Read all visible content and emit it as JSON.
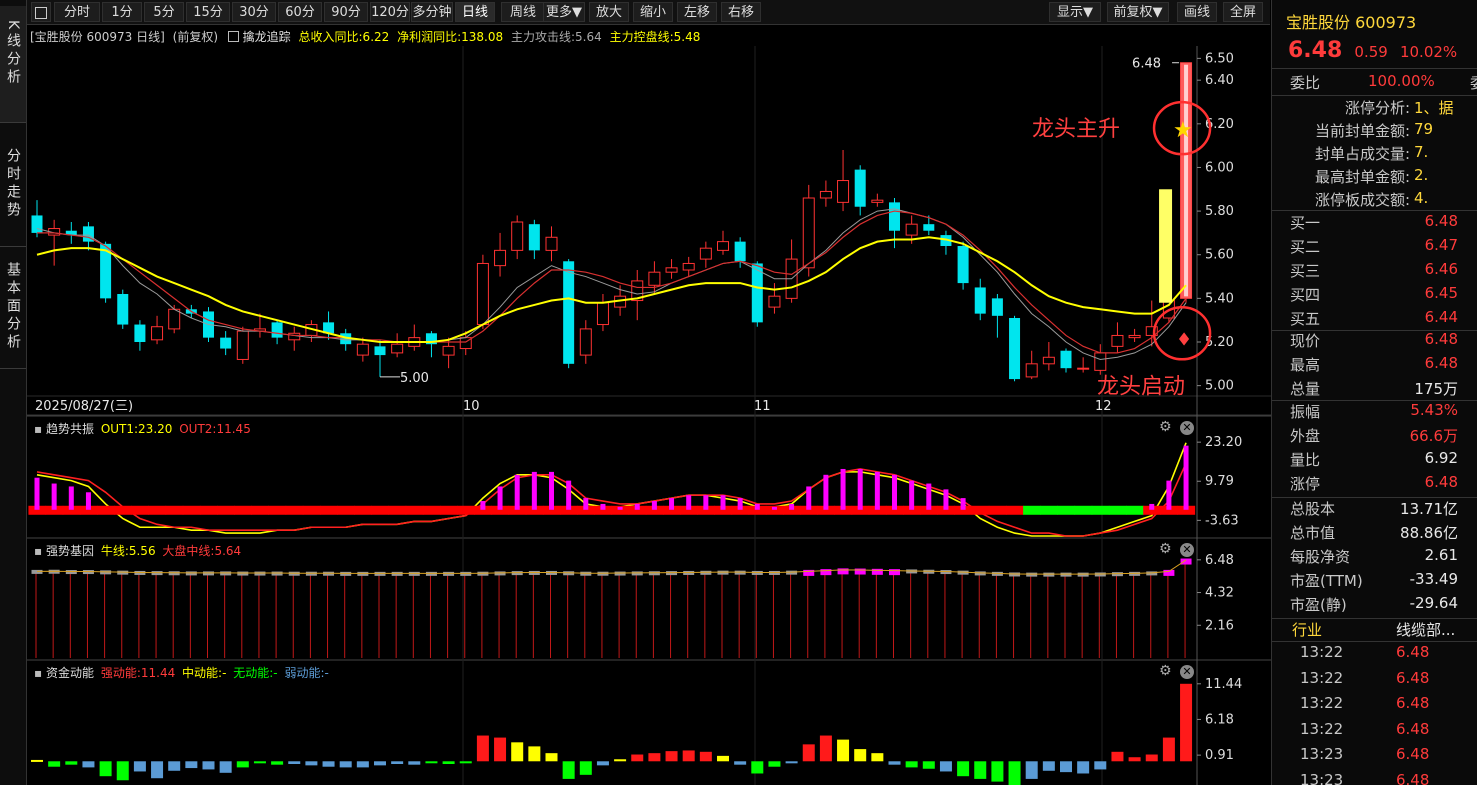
{
  "left_tabs": [
    "K线分析",
    "分时走势",
    "基本面分析"
  ],
  "toolbar": {
    "items": [
      "分时",
      "1分",
      "5分",
      "15分",
      "30分",
      "60分",
      "90分",
      "120分",
      "多分钟",
      "日线",
      "周线",
      "更多▼",
      "放大",
      "缩小",
      "左移",
      "右移"
    ],
    "active": "日线",
    "right_items": [
      "显示▼",
      "前复权▼",
      "画线",
      "全屏"
    ]
  },
  "main_header": {
    "title": "[宝胜股份 600973 日线]",
    "adj": "(前复权)",
    "indicator": "擒龙追踪",
    "rev_label": "总收入同比:6.22",
    "profit_label": "净利润同比:138.08",
    "attack_label": "主力攻击线:5.64",
    "control_label": "主力控盘线:5.48"
  },
  "annotations": {
    "top_right_price": "6.48",
    "low_price": "5.00",
    "dragon_up": "龙头主升",
    "dragon_start": "龙头启动"
  },
  "x_labels": [
    "2025/08/27(三)",
    "10",
    "11",
    "12"
  ],
  "panel2": {
    "title": "趋势共振",
    "out1": "OUT1:23.20",
    "out2": "OUT2:11.45",
    "ticks": [
      "23.20",
      "9.79",
      "-3.63"
    ]
  },
  "panel3": {
    "title": "强势基因",
    "bull": "牛线:5.56",
    "mid": "大盘中线:5.64",
    "ticks": [
      "6.48",
      "4.32",
      "2.16"
    ]
  },
  "panel4": {
    "title": "资金动能",
    "strong": "强动能:11.44",
    "medium": "中动能:-",
    "none": "无动能:-",
    "weak": "弱动能:-",
    "ticks": [
      "11.44",
      "6.18",
      "0.91"
    ]
  },
  "colors": {
    "up": "#ff3232",
    "down": "#00e5ee",
    "ma_yellow": "#ffff00",
    "magenta": "#ff00ff",
    "green": "#00ff00",
    "blue": "#5b9bd5"
  },
  "quote": {
    "name": "宝胜股份",
    "code": "600973",
    "price": "6.48",
    "change": "0.59",
    "pct": "10.02%",
    "weibi_label": "委比",
    "weibi": "100.00%",
    "weibi_unit": "委"
  },
  "limit_info": [
    {
      "label": "涨停分析:",
      "value": "1、据"
    },
    {
      "label": "当前封单金额:",
      "value": "79"
    },
    {
      "label": "封单占成交量:",
      "value": "7."
    },
    {
      "label": "最高封单金额:",
      "value": "2."
    },
    {
      "label": "涨停板成交额:",
      "value": "4."
    }
  ],
  "order_book": [
    {
      "label": "买一",
      "value": "6.48"
    },
    {
      "label": "买二",
      "value": "6.47"
    },
    {
      "label": "买三",
      "value": "6.46"
    },
    {
      "label": "买四",
      "value": "6.45"
    },
    {
      "label": "买五",
      "value": "6.44"
    }
  ],
  "stats1": [
    {
      "label": "现价",
      "value": "6.48",
      "color": "red"
    },
    {
      "label": "最高",
      "value": "6.48",
      "color": "red"
    },
    {
      "label": "总量",
      "value": "175万",
      "color": "white"
    }
  ],
  "stats2": [
    {
      "label": "振幅",
      "value": "5.43%",
      "color": "red"
    },
    {
      "label": "外盘",
      "value": "66.6万",
      "color": "red"
    },
    {
      "label": "量比",
      "value": "6.92",
      "color": "white"
    },
    {
      "label": "涨停",
      "value": "6.48",
      "color": "red"
    }
  ],
  "stats3": [
    {
      "label": "总股本",
      "value": "13.71亿",
      "color": "white"
    },
    {
      "label": "总市值",
      "value": "88.86亿",
      "color": "white"
    },
    {
      "label": "每股净资",
      "value": "2.61",
      "color": "white"
    },
    {
      "label": "市盈(TTM)",
      "value": "-33.49",
      "color": "white"
    },
    {
      "label": "市盈(静)",
      "value": "-29.64",
      "color": "white"
    }
  ],
  "industry": {
    "label": "行业",
    "value": "线缆部..."
  },
  "ticks_list": [
    {
      "time": "13:22",
      "price": "6.48"
    },
    {
      "time": "13:22",
      "price": "6.48"
    },
    {
      "time": "13:22",
      "price": "6.48"
    },
    {
      "time": "13:22",
      "price": "6.48"
    },
    {
      "time": "13:23",
      "price": "6.48"
    },
    {
      "time": "13:23",
      "price": "6.48"
    }
  ],
  "chart_data": {
    "type": "candlestick",
    "y_ticks": [
      "6.50",
      "6.40",
      "6.20",
      "6.00",
      "5.80",
      "5.60",
      "5.40",
      "5.20",
      "5.00"
    ],
    "ylim": [
      4.98,
      6.52
    ],
    "candles": [
      [
        5.78,
        5.7,
        5.85,
        5.68
      ],
      [
        5.69,
        5.72,
        5.76,
        5.55
      ],
      [
        5.71,
        5.69,
        5.75,
        5.65
      ],
      [
        5.73,
        5.66,
        5.75,
        5.62
      ],
      [
        5.65,
        5.4,
        5.66,
        5.38
      ],
      [
        5.42,
        5.28,
        5.44,
        5.26
      ],
      [
        5.28,
        5.2,
        5.3,
        5.16
      ],
      [
        5.21,
        5.27,
        5.32,
        5.19
      ],
      [
        5.26,
        5.35,
        5.37,
        5.24
      ],
      [
        5.35,
        5.33,
        5.37,
        5.31
      ],
      [
        5.34,
        5.22,
        5.36,
        5.2
      ],
      [
        5.22,
        5.17,
        5.25,
        5.14
      ],
      [
        5.12,
        5.25,
        5.27,
        5.1
      ],
      [
        5.25,
        5.26,
        5.33,
        5.22
      ],
      [
        5.29,
        5.22,
        5.3,
        5.19
      ],
      [
        5.21,
        5.24,
        5.27,
        5.16
      ],
      [
        5.23,
        5.28,
        5.3,
        5.2
      ],
      [
        5.29,
        5.24,
        5.34,
        5.21
      ],
      [
        5.24,
        5.19,
        5.26,
        5.16
      ],
      [
        5.14,
        5.19,
        5.22,
        5.11
      ],
      [
        5.18,
        5.14,
        5.21,
        5.04
      ],
      [
        5.15,
        5.19,
        5.24,
        5.13
      ],
      [
        5.18,
        5.22,
        5.28,
        5.16
      ],
      [
        5.24,
        5.19,
        5.25,
        5.13
      ],
      [
        5.14,
        5.18,
        5.22,
        5.08
      ],
      [
        5.17,
        5.22,
        5.25,
        5.14
      ],
      [
        5.28,
        5.56,
        5.6,
        5.26
      ],
      [
        5.55,
        5.62,
        5.7,
        5.5
      ],
      [
        5.62,
        5.75,
        5.78,
        5.58
      ],
      [
        5.74,
        5.62,
        5.76,
        5.58
      ],
      [
        5.62,
        5.68,
        5.73,
        5.57
      ],
      [
        5.57,
        5.1,
        5.58,
        5.08
      ],
      [
        5.14,
        5.26,
        5.3,
        5.1
      ],
      [
        5.28,
        5.38,
        5.42,
        5.25
      ],
      [
        5.36,
        5.41,
        5.46,
        5.32
      ],
      [
        5.39,
        5.48,
        5.53,
        5.3
      ],
      [
        5.46,
        5.52,
        5.57,
        5.42
      ],
      [
        5.52,
        5.54,
        5.58,
        5.49
      ],
      [
        5.53,
        5.56,
        5.59,
        5.5
      ],
      [
        5.58,
        5.63,
        5.66,
        5.54
      ],
      [
        5.62,
        5.66,
        5.71,
        5.6
      ],
      [
        5.66,
        5.57,
        5.68,
        5.54
      ],
      [
        5.56,
        5.29,
        5.57,
        5.27
      ],
      [
        5.36,
        5.41,
        5.47,
        5.33
      ],
      [
        5.4,
        5.58,
        5.67,
        5.38
      ],
      [
        5.54,
        5.86,
        5.92,
        5.5
      ],
      [
        5.86,
        5.89,
        5.94,
        5.82
      ],
      [
        5.84,
        5.94,
        6.08,
        5.8
      ],
      [
        5.99,
        5.82,
        6.01,
        5.78
      ],
      [
        5.84,
        5.85,
        5.88,
        5.82
      ],
      [
        5.84,
        5.71,
        5.86,
        5.63
      ],
      [
        5.69,
        5.74,
        5.78,
        5.65
      ],
      [
        5.74,
        5.71,
        5.78,
        5.69
      ],
      [
        5.69,
        5.64,
        5.71,
        5.6
      ],
      [
        5.64,
        5.47,
        5.66,
        5.44
      ],
      [
        5.45,
        5.33,
        5.49,
        5.3
      ],
      [
        5.4,
        5.32,
        5.42,
        5.22
      ],
      [
        5.31,
        5.03,
        5.32,
        5.02
      ],
      [
        5.04,
        5.1,
        5.16,
        5.03
      ],
      [
        5.1,
        5.13,
        5.2,
        5.07
      ],
      [
        5.16,
        5.08,
        5.17,
        5.06
      ],
      [
        5.08,
        5.08,
        5.13,
        5.06
      ],
      [
        5.07,
        5.15,
        5.19,
        5.05
      ],
      [
        5.18,
        5.23,
        5.29,
        5.15
      ],
      [
        5.22,
        5.23,
        5.26,
        5.2
      ],
      [
        5.23,
        5.27,
        5.39,
        5.18
      ],
      [
        5.31,
        5.39,
        5.55,
        5.29
      ],
      [
        5.4,
        6.48,
        6.48,
        5.38
      ]
    ],
    "ma_gray": [
      5.72,
      5.7,
      5.69,
      5.69,
      5.64,
      5.55,
      5.47,
      5.42,
      5.35,
      5.31,
      5.28,
      5.27,
      5.25,
      5.25,
      5.24,
      5.23,
      5.22,
      5.22,
      5.21,
      5.21,
      5.2,
      5.2,
      5.2,
      5.2,
      5.21,
      5.22,
      5.28,
      5.36,
      5.45,
      5.5,
      5.55,
      5.52,
      5.5,
      5.47,
      5.44,
      5.42,
      5.43,
      5.47,
      5.5,
      5.53,
      5.56,
      5.57,
      5.53,
      5.49,
      5.49,
      5.56,
      5.62,
      5.7,
      5.76,
      5.8,
      5.81,
      5.79,
      5.77,
      5.74,
      5.68,
      5.6,
      5.52,
      5.42,
      5.33,
      5.27,
      5.2,
      5.15,
      5.12,
      5.13,
      5.15,
      5.19,
      5.27,
      5.38
    ],
    "ma_red": [
      5.7,
      5.7,
      5.69,
      5.68,
      5.64,
      5.58,
      5.52,
      5.46,
      5.4,
      5.34,
      5.3,
      5.28,
      5.26,
      5.25,
      5.24,
      5.23,
      5.23,
      5.22,
      5.22,
      5.21,
      5.21,
      5.2,
      5.2,
      5.2,
      5.2,
      5.2,
      5.25,
      5.32,
      5.4,
      5.47,
      5.53,
      5.53,
      5.52,
      5.5,
      5.47,
      5.45,
      5.45,
      5.47,
      5.5,
      5.53,
      5.56,
      5.57,
      5.55,
      5.52,
      5.51,
      5.56,
      5.61,
      5.68,
      5.74,
      5.78,
      5.8,
      5.79,
      5.77,
      5.74,
      5.69,
      5.62,
      5.54,
      5.45,
      5.37,
      5.3,
      5.23,
      5.18,
      5.15,
      5.15,
      5.17,
      5.22,
      5.29,
      5.4
    ],
    "ma_yellow": [
      5.6,
      5.62,
      5.63,
      5.63,
      5.62,
      5.58,
      5.54,
      5.5,
      5.47,
      5.44,
      5.41,
      5.37,
      5.34,
      5.32,
      5.3,
      5.28,
      5.26,
      5.24,
      5.22,
      5.21,
      5.2,
      5.2,
      5.2,
      5.2,
      5.21,
      5.24,
      5.28,
      5.32,
      5.35,
      5.37,
      5.39,
      5.4,
      5.38,
      5.38,
      5.39,
      5.4,
      5.42,
      5.44,
      5.46,
      5.47,
      5.47,
      5.47,
      5.45,
      5.44,
      5.45,
      5.48,
      5.52,
      5.58,
      5.63,
      5.66,
      5.67,
      5.67,
      5.68,
      5.67,
      5.65,
      5.61,
      5.57,
      5.52,
      5.46,
      5.41,
      5.38,
      5.36,
      5.35,
      5.34,
      5.33,
      5.33,
      5.37,
      5.46
    ],
    "panel2": {
      "range": [
        -9.0,
        26.0
      ],
      "magenta_bars": [
        11,
        9,
        8,
        6,
        0,
        0,
        0,
        0,
        0,
        0,
        0,
        0,
        0,
        0,
        0,
        0,
        0,
        0,
        0,
        0,
        0,
        0,
        0,
        0,
        0,
        0,
        3,
        8,
        12,
        13,
        13,
        10,
        4,
        2,
        1,
        2,
        3,
        4,
        5,
        5,
        5,
        4,
        2,
        1,
        2,
        8,
        12,
        14,
        14,
        13,
        12,
        10,
        9,
        7,
        4,
        0,
        0,
        0,
        0,
        0,
        0,
        0,
        0,
        0,
        0,
        2,
        10,
        22
      ],
      "bar_state": [
        "m",
        "m",
        "m",
        "m",
        "r",
        "r",
        "r",
        "r",
        "r",
        "r",
        "r",
        "r",
        "r",
        "r",
        "r",
        "r",
        "r",
        "r",
        "r",
        "r",
        "r",
        "r",
        "r",
        "r",
        "r",
        "r",
        "m",
        "m",
        "m",
        "m",
        "m",
        "m",
        "m",
        "m",
        "m",
        "m",
        "m",
        "m",
        "m",
        "m",
        "m",
        "m",
        "m",
        "m",
        "m",
        "m",
        "m",
        "m",
        "m",
        "m",
        "m",
        "m",
        "m",
        "m",
        "m",
        "r",
        "r",
        "r",
        "g",
        "g",
        "g",
        "g",
        "g",
        "g",
        "g",
        "r",
        "r",
        "m"
      ],
      "out1": [
        12,
        11,
        10,
        8,
        2,
        -3,
        -6,
        -6,
        -6,
        -7,
        -7,
        -8,
        -8,
        -8,
        -7,
        -7,
        -6,
        -6,
        -6,
        -5,
        -5,
        -5,
        -4,
        -4,
        -3,
        -2,
        4,
        9,
        12,
        12,
        11,
        7,
        2,
        1,
        1,
        2,
        3,
        4,
        5,
        5,
        4,
        3,
        1,
        1,
        2,
        7,
        11,
        13,
        13,
        12,
        11,
        9,
        7,
        5,
        2,
        -3,
        -6,
        -8,
        -9,
        -9,
        -9,
        -9,
        -8,
        -6,
        -4,
        -2,
        8,
        23
      ],
      "out2": [
        13,
        12,
        11,
        10,
        6,
        1,
        -3,
        -5,
        -6,
        -6,
        -7,
        -7,
        -7,
        -7,
        -7,
        -7,
        -6,
        -6,
        -6,
        -5,
        -5,
        -5,
        -4,
        -4,
        -3,
        -2,
        2,
        7,
        11,
        12,
        12,
        9,
        4,
        3,
        2,
        2,
        3,
        4,
        5,
        5,
        5,
        4,
        2,
        2,
        3,
        7,
        11,
        13,
        14,
        13,
        12,
        10,
        8,
        6,
        3,
        -1,
        -4,
        -6,
        -8,
        -8,
        -9,
        -9,
        -8,
        -7,
        -5,
        -3,
        3,
        16
      ]
    },
    "panel3": {
      "range": [
        0,
        6.6
      ],
      "base": [
        5.65,
        5.66,
        5.64,
        5.64,
        5.62,
        5.6,
        5.58,
        5.57,
        5.56,
        5.55,
        5.55,
        5.55,
        5.54,
        5.54,
        5.54,
        5.53,
        5.53,
        5.53,
        5.52,
        5.52,
        5.52,
        5.52,
        5.52,
        5.52,
        5.52,
        5.52,
        5.53,
        5.55,
        5.57,
        5.58,
        5.58,
        5.56,
        5.53,
        5.53,
        5.54,
        5.55,
        5.56,
        5.57,
        5.58,
        5.59,
        5.6,
        5.6,
        5.58,
        5.58,
        5.6,
        5.65,
        5.7,
        5.75,
        5.74,
        5.72,
        5.7,
        5.68,
        5.66,
        5.64,
        5.6,
        5.55,
        5.52,
        5.48,
        5.47,
        5.47,
        5.47,
        5.47,
        5.48,
        5.5,
        5.52,
        5.55,
        5.65,
        6.4
      ],
      "magenta_idx": [
        45,
        46,
        47,
        48,
        49,
        50,
        66,
        67
      ]
    },
    "panel4": {
      "range": [
        -3.5,
        12.0
      ],
      "values": [
        0.2,
        -0.8,
        -0.5,
        -0.9,
        -2.2,
        -2.8,
        -1.5,
        -2.5,
        -1.4,
        -1.0,
        -1.2,
        -1.7,
        -0.9,
        -0.3,
        -0.5,
        -0.4,
        -0.6,
        -0.8,
        -0.9,
        -0.9,
        -0.6,
        -0.4,
        -0.5,
        -0.2,
        -0.4,
        -0.3,
        3.8,
        3.5,
        2.8,
        2.2,
        1.2,
        -2.6,
        -2.0,
        -0.6,
        0.3,
        1.0,
        1.2,
        1.5,
        1.6,
        1.4,
        0.8,
        -0.5,
        -1.8,
        -0.8,
        -0.3,
        2.5,
        3.8,
        3.2,
        1.8,
        1.2,
        -0.5,
        -0.9,
        -1.1,
        -1.5,
        -2.2,
        -2.6,
        -3.0,
        -3.5,
        -2.6,
        -1.4,
        -1.6,
        -1.8,
        -1.2,
        1.4,
        0.6,
        1.0,
        3.5,
        11.44
      ],
      "colors": [
        "y",
        "g",
        "g",
        "b",
        "g",
        "g",
        "b",
        "b",
        "b",
        "b",
        "b",
        "b",
        "g",
        "g",
        "g",
        "b",
        "b",
        "b",
        "b",
        "b",
        "b",
        "b",
        "b",
        "g",
        "g",
        "g",
        "r",
        "r",
        "y",
        "y",
        "y",
        "g",
        "g",
        "b",
        "y",
        "r",
        "r",
        "r",
        "r",
        "r",
        "y",
        "b",
        "g",
        "g",
        "b",
        "r",
        "r",
        "y",
        "y",
        "y",
        "b",
        "g",
        "g",
        "b",
        "g",
        "g",
        "g",
        "g",
        "b",
        "b",
        "b",
        "b",
        "b",
        "r",
        "r",
        "r",
        "r",
        "r"
      ]
    }
  }
}
